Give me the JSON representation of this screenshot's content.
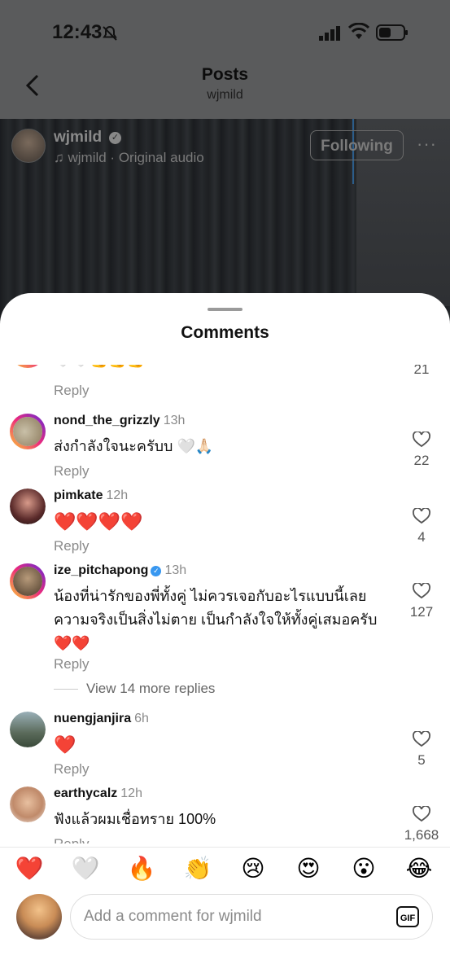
{
  "status_bar": {
    "time": "12:43"
  },
  "header": {
    "title": "Posts",
    "subtitle": "wjmild"
  },
  "video": {
    "username": "wjmild",
    "audio": "wjmild · Original audio",
    "follow_label": "Following",
    "more": "···"
  },
  "sheet": {
    "title": "Comments"
  },
  "comments": [
    {
      "user": "",
      "time": "",
      "text": "🤍🤍💪💪💪",
      "reply": "Reply",
      "likes": "21"
    },
    {
      "user": "nond_the_grizzly",
      "time": "13h",
      "text": "ส่งกำลังใจนะครับบ 🤍🙏🏻",
      "reply": "Reply",
      "likes": "22"
    },
    {
      "user": "pimkate",
      "time": "12h",
      "text": "❤️❤️❤️❤️",
      "reply": "Reply",
      "likes": "4"
    },
    {
      "user": "ize_pitchapong",
      "time": "13h",
      "text": "น้องที่น่ารักของพี่ทั้งคู่ ไม่ควรเจอกับอะไรแบบนี้เลย ความจริงเป็นสิ่งไม่ตาย เป็นกำลังใจให้ทั้งคู่เสมอครับ ❤️❤️",
      "reply": "Reply",
      "likes": "127",
      "view_more": "View 14 more replies"
    },
    {
      "user": "nuengjanjira",
      "time": "6h",
      "text": "❤️",
      "reply": "Reply",
      "likes": "5"
    },
    {
      "user": "earthycalz",
      "time": "12h",
      "text": "ฟังแล้วผมเชื่อทราย 100%",
      "reply": "Reply",
      "likes": "1,668"
    }
  ],
  "reactions": [
    "❤️",
    "🤍",
    "🔥",
    "👏",
    "😢",
    "😍",
    "😮",
    "😂"
  ],
  "composer": {
    "placeholder": "Add a comment for wjmild",
    "gif_label": "GIF"
  }
}
